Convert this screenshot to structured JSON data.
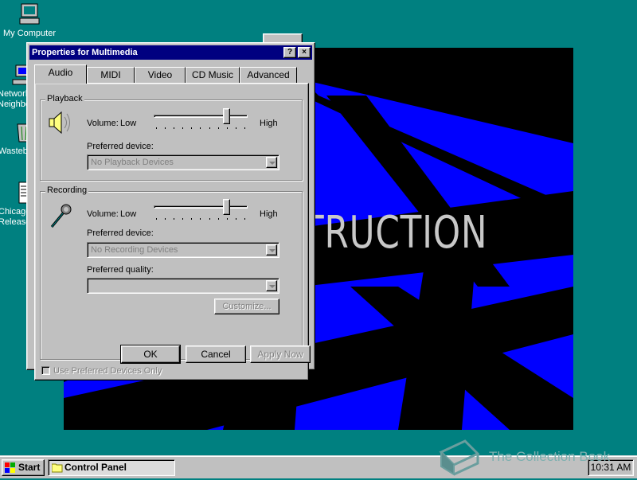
{
  "desktop": {
    "icons": [
      {
        "label": "My Computer",
        "icon": "computer-icon"
      },
      {
        "label": "Network Neighborhood",
        "icon": "network-icon"
      },
      {
        "label": "Wastebasket",
        "icon": "recycle-bin-icon"
      },
      {
        "label": "Chicago Release",
        "icon": "notepad-icon"
      }
    ],
    "wallpaper_text": "TRUCTION"
  },
  "dialog": {
    "title": "Properties for Multimedia",
    "help_btn": "?",
    "close_btn": "×",
    "tabs": [
      {
        "label": "Audio",
        "active": true
      },
      {
        "label": "MIDI",
        "active": false
      },
      {
        "label": "Video",
        "active": false
      },
      {
        "label": "CD Music",
        "active": false
      },
      {
        "label": "Advanced",
        "active": false
      }
    ],
    "playback": {
      "legend": "Playback",
      "volume_label": "Volume:",
      "low": "Low",
      "high": "High",
      "volume_level": 0.85,
      "device_label": "Preferred device:",
      "device_value": "No Playback Devices"
    },
    "recording": {
      "legend": "Recording",
      "volume_label": "Volume:",
      "low": "Low",
      "high": "High",
      "volume_level": 0.85,
      "device_label": "Preferred device:",
      "device_value": "No Recording Devices",
      "quality_label": "Preferred quality:",
      "quality_value": "",
      "customize_btn": "Customize..."
    },
    "use_preferred_only": "Use Preferred Devices Only",
    "ok_btn": "OK",
    "cancel_btn": "Cancel",
    "apply_btn": "Apply Now"
  },
  "taskbar": {
    "start": "Start",
    "task": "Control Panel",
    "clock": "10:31 AM"
  },
  "watermark": "The Collection Book"
}
